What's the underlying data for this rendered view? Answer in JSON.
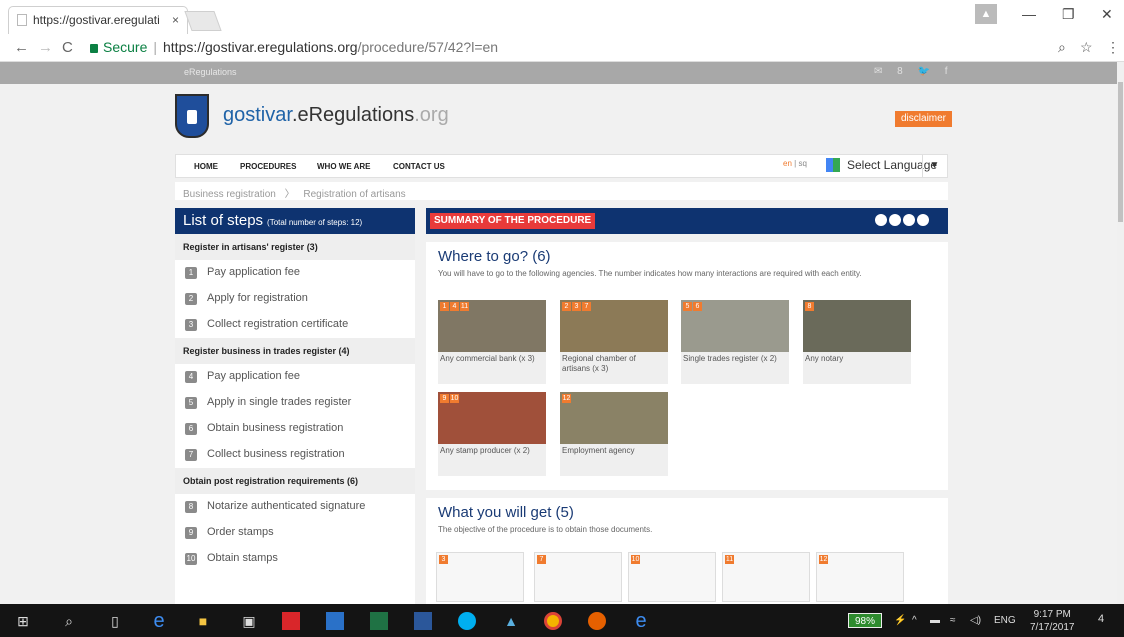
{
  "browser": {
    "tab_title": "https://gostivar.eregulati",
    "tab_close": "×",
    "secure_label": "Secure",
    "url_host": "https://gostivar.eregulations.org",
    "url_path": "/procedure/57/42?l=en"
  },
  "site": {
    "strip_label": "eRegulations",
    "brand_main": "gostivar",
    "brand_mid": ".eRegulations",
    "brand_tld": ".org",
    "disclaimer": "disclaimer",
    "menu": [
      "HOME",
      "PROCEDURES",
      "WHO WE ARE",
      "CONTACT US"
    ],
    "lang_en": "en",
    "lang_sep": " | ",
    "lang_sq": "sq",
    "select_language": "Select Language",
    "breadcrumb_1": "Business registration",
    "breadcrumb_sep": "〉",
    "breadcrumb_2": "Registration of artisans"
  },
  "steps_panel": {
    "title": "List of steps",
    "total": "(Total number of steps: 12)",
    "groups": [
      {
        "title": "Register in artisans' register (3)",
        "steps": [
          {
            "num": "1",
            "label": "Pay application fee"
          },
          {
            "num": "2",
            "label": "Apply for registration"
          },
          {
            "num": "3",
            "label": "Collect registration certificate"
          }
        ]
      },
      {
        "title": "Register business in trades register (4)",
        "steps": [
          {
            "num": "4",
            "label": "Pay application fee"
          },
          {
            "num": "5",
            "label": "Apply in single trades register"
          },
          {
            "num": "6",
            "label": "Obtain business registration"
          },
          {
            "num": "7",
            "label": "Collect business registration"
          }
        ]
      },
      {
        "title": "Obtain post registration requirements (6)",
        "steps": [
          {
            "num": "8",
            "label": "Notarize authenticated signature"
          },
          {
            "num": "9",
            "label": "Order stamps"
          },
          {
            "num": "10",
            "label": "Obtain stamps"
          }
        ]
      }
    ]
  },
  "summary": {
    "header": "SUMMARY OF THE PROCEDURE",
    "where_title": "Where to go? (6)",
    "where_desc": "You will have to go to the following agencies. The number indicates how many interactions are required with each entity.",
    "agencies": [
      {
        "badges": [
          "1",
          "4",
          "11"
        ],
        "caption": "Any commercial bank (x 3)"
      },
      {
        "badges": [
          "2",
          "3",
          "7"
        ],
        "caption": "Regional chamber of artisans (x 3)"
      },
      {
        "badges": [
          "5",
          "6"
        ],
        "caption": "Single trades register (x 2)"
      },
      {
        "badges": [
          "8"
        ],
        "caption": "Any notary"
      },
      {
        "badges": [
          "9",
          "10"
        ],
        "caption": "Any stamp producer (x 2)"
      },
      {
        "badges": [
          "12"
        ],
        "caption": "Employment agency"
      }
    ],
    "get_title": "What you will get (5)",
    "get_desc": "The objective of the procedure is to obtain those documents.",
    "docs": [
      "3",
      "7",
      "10",
      "11",
      "12"
    ]
  },
  "taskbar": {
    "battery": "98%",
    "lang": "ENG",
    "time": "9:17 PM",
    "date": "7/17/2017",
    "notif": "4"
  }
}
